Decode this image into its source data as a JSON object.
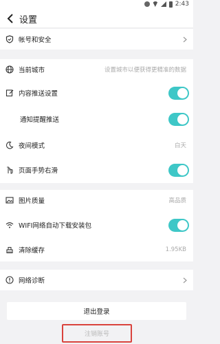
{
  "status": {
    "time": "2:43"
  },
  "header": {
    "title": "设置"
  },
  "rows": {
    "account": {
      "label": "帐号和安全"
    },
    "city": {
      "label": "当前城市",
      "value": "设置城市以便获得更精准的数据"
    },
    "content_push": {
      "label": "内容推送设置",
      "on": true
    },
    "notify_push": {
      "label": "通知提醒推送",
      "on": true
    },
    "night_mode": {
      "label": "夜间模式",
      "value": "白天"
    },
    "swipe_right": {
      "label": "页面手势右滑",
      "on": true
    },
    "image_quality": {
      "label": "图片质量",
      "value": "高品质"
    },
    "wifi_download": {
      "label": "WIFI网络自动下载安装包",
      "on": true
    },
    "clear_cache": {
      "label": "清除缓存",
      "value": "1.95KB"
    },
    "network_diag": {
      "label": "网络诊断"
    }
  },
  "buttons": {
    "logout": "退出登录",
    "cancel_account": "注销账号"
  },
  "colors": {
    "toggle_on": "#3ec7c7",
    "highlight": "#d9423c"
  }
}
